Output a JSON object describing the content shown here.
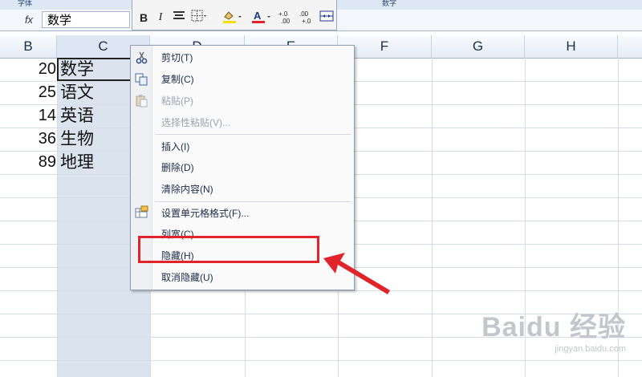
{
  "ribbon": {
    "left_label": "字体",
    "right_label": "数字"
  },
  "formula_bar": {
    "fx_label": "fx",
    "value": "数学"
  },
  "columns": [
    "B",
    "C",
    "D",
    "E",
    "F",
    "G",
    "H"
  ],
  "rows": [
    {
      "num": "20",
      "text": "数学"
    },
    {
      "num": "25",
      "text": "语文"
    },
    {
      "num": "14",
      "text": "英语"
    },
    {
      "num": "36",
      "text": "生物"
    },
    {
      "num": "89",
      "text": "地理"
    }
  ],
  "mini_toolbar": {
    "bold": "B",
    "italic": "I",
    "font_color_label": "A",
    "increase_decimal": "+.0 .00",
    "decrease_decimal": ".00 +.0"
  },
  "context_menu": {
    "cut": "剪切(T)",
    "copy": "复制(C)",
    "paste": "粘贴(P)",
    "paste_special": "选择性粘贴(V)...",
    "insert": "插入(I)",
    "delete": "删除(D)",
    "clear_contents": "清除内容(N)",
    "format_cells": "设置单元格格式(F)...",
    "column_width": "列宽(C)...",
    "hide": "隐藏(H)",
    "unhide": "取消隐藏(U)"
  },
  "icons": {
    "cut": "scissors-icon",
    "copy": "copy-icon",
    "paste": "paste-icon",
    "format": "format-cells-icon",
    "fill": "fill-color-icon",
    "font_color": "font-color-icon",
    "borders": "borders-icon",
    "align": "align-center-icon"
  },
  "colors": {
    "highlight_red": "#e0242a",
    "font_color_underline": "#e0242a",
    "fill_color_underline": "#f4e000"
  },
  "watermark": {
    "main": "Baidu 经验",
    "sub": "jingyan.baidu.com"
  }
}
